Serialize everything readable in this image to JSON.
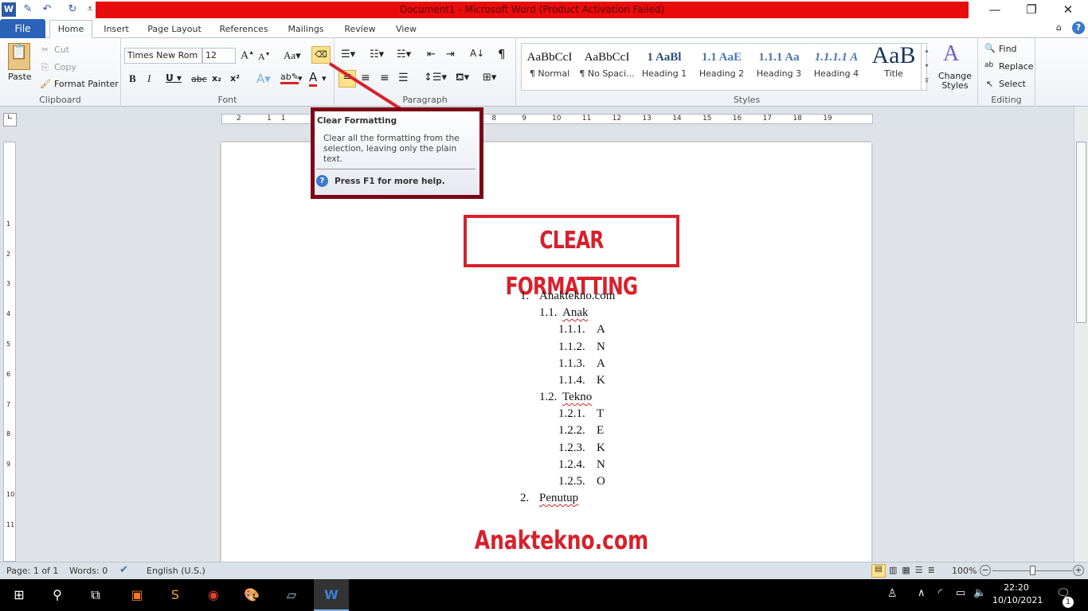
{
  "window": {
    "title": "Document1 - Microsoft Word (Product Activation Failed)",
    "title_bar_color": "#e90c0c"
  },
  "quick_access": [
    "word-icon",
    "save-icon",
    "undo-icon",
    "redo-icon",
    "customize-icon"
  ],
  "tabs": {
    "file": "File",
    "items": [
      "Home",
      "Insert",
      "Page Layout",
      "References",
      "Mailings",
      "Review",
      "View"
    ],
    "active": "Home"
  },
  "ribbon": {
    "clipboard": {
      "label": "Clipboard",
      "paste": "Paste",
      "cut": "Cut",
      "copy": "Copy",
      "format_painter": "Format Painter"
    },
    "font": {
      "label": "Font",
      "font_name": "Times New Rom",
      "font_size": "12",
      "change_case": "Aa"
    },
    "paragraph": {
      "label": "Paragraph"
    },
    "styles": {
      "label": "Styles",
      "items": [
        {
          "preview": "AaBbCcI",
          "name": "¶ Normal"
        },
        {
          "preview": "AaBbCcI",
          "name": "¶ No Spaci..."
        },
        {
          "preview": "1 AaBl",
          "name": "Heading 1"
        },
        {
          "preview": "1.1 AaE",
          "name": "Heading 2"
        },
        {
          "preview": "1.1.1 Aa",
          "name": "Heading 3"
        },
        {
          "preview": "1.1.1.1 A",
          "name": "Heading 4"
        },
        {
          "preview": "AaB",
          "name": "Title"
        }
      ],
      "change_styles": "Change Styles"
    },
    "editing": {
      "label": "Editing",
      "find": "Find",
      "replace": "Replace",
      "select": "Select"
    }
  },
  "tooltip": {
    "title": "Clear Formatting",
    "body": "Clear all the formatting from the selection, leaving only the plain text.",
    "help": "Press F1 for more help."
  },
  "document": {
    "banner": "CLEAR FORMATTING",
    "list": [
      {
        "num": "1.",
        "text": "Anaktekno.com",
        "level": 0
      },
      {
        "num": "1.1.",
        "text": "Anak",
        "level": 1,
        "squiggle": true
      },
      {
        "num": "1.1.1.",
        "text": "A",
        "level": 2
      },
      {
        "num": "1.1.2.",
        "text": "N",
        "level": 2
      },
      {
        "num": "1.1.3.",
        "text": "A",
        "level": 2
      },
      {
        "num": "1.1.4.",
        "text": "K",
        "level": 2
      },
      {
        "num": "1.2.",
        "text": "Tekno",
        "level": 1,
        "squiggle": true
      },
      {
        "num": "1.2.1.",
        "text": "T",
        "level": 2
      },
      {
        "num": "1.2.2.",
        "text": "E",
        "level": 2
      },
      {
        "num": "1.2.3.",
        "text": "K",
        "level": 2
      },
      {
        "num": "1.2.4.",
        "text": "N",
        "level": 2
      },
      {
        "num": "1.2.5.",
        "text": "O",
        "level": 2
      },
      {
        "num": "2.",
        "text": "Penutup",
        "level": 0,
        "squiggle": true
      }
    ],
    "watermark": "Anaktekno.com",
    "accent": "#d8202b"
  },
  "status": {
    "page": "Page: 1 of 1",
    "words": "Words: 0",
    "language": "English (U.S.)",
    "zoom": "100%",
    "zoom_percent": 100
  },
  "taskbar": {
    "time": "22:20",
    "date": "10/10/2021",
    "notifications": "1",
    "apps": [
      "xampp-icon",
      "sublime-icon",
      "chrome-icon",
      "paint-icon",
      "notepad-icon",
      "word-icon"
    ]
  }
}
